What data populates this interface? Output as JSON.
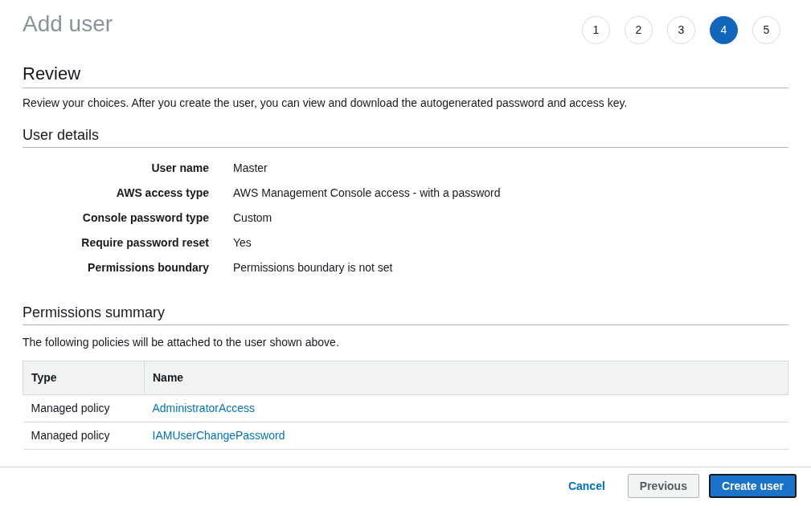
{
  "title": "Add user",
  "steps": [
    {
      "label": "1",
      "selected": false
    },
    {
      "label": "2",
      "selected": false
    },
    {
      "label": "3",
      "selected": false
    },
    {
      "label": "4",
      "selected": true
    },
    {
      "label": "5",
      "selected": false
    }
  ],
  "review": {
    "heading": "Review",
    "description": "Review your choices. After you create the user, you can view and download the autogenerated password and access key."
  },
  "user_details": {
    "heading": "User details",
    "rows": [
      {
        "label": "User name",
        "value": "Master"
      },
      {
        "label": "AWS access type",
        "value": "AWS Management Console access - with a password"
      },
      {
        "label": "Console password type",
        "value": "Custom"
      },
      {
        "label": "Require password reset",
        "value": "Yes"
      },
      {
        "label": "Permissions boundary",
        "value": "Permissions boundary is not set"
      }
    ]
  },
  "permissions": {
    "heading": "Permissions summary",
    "description": "The following policies will be attached to the user shown above.",
    "columns": [
      "Type",
      "Name"
    ],
    "rows": [
      {
        "type": "Managed policy",
        "name": "AdministratorAccess"
      },
      {
        "type": "Managed policy",
        "name": "IAMUserChangePassword"
      }
    ]
  },
  "footer": {
    "cancel": "Cancel",
    "previous": "Previous",
    "create": "Create user"
  }
}
